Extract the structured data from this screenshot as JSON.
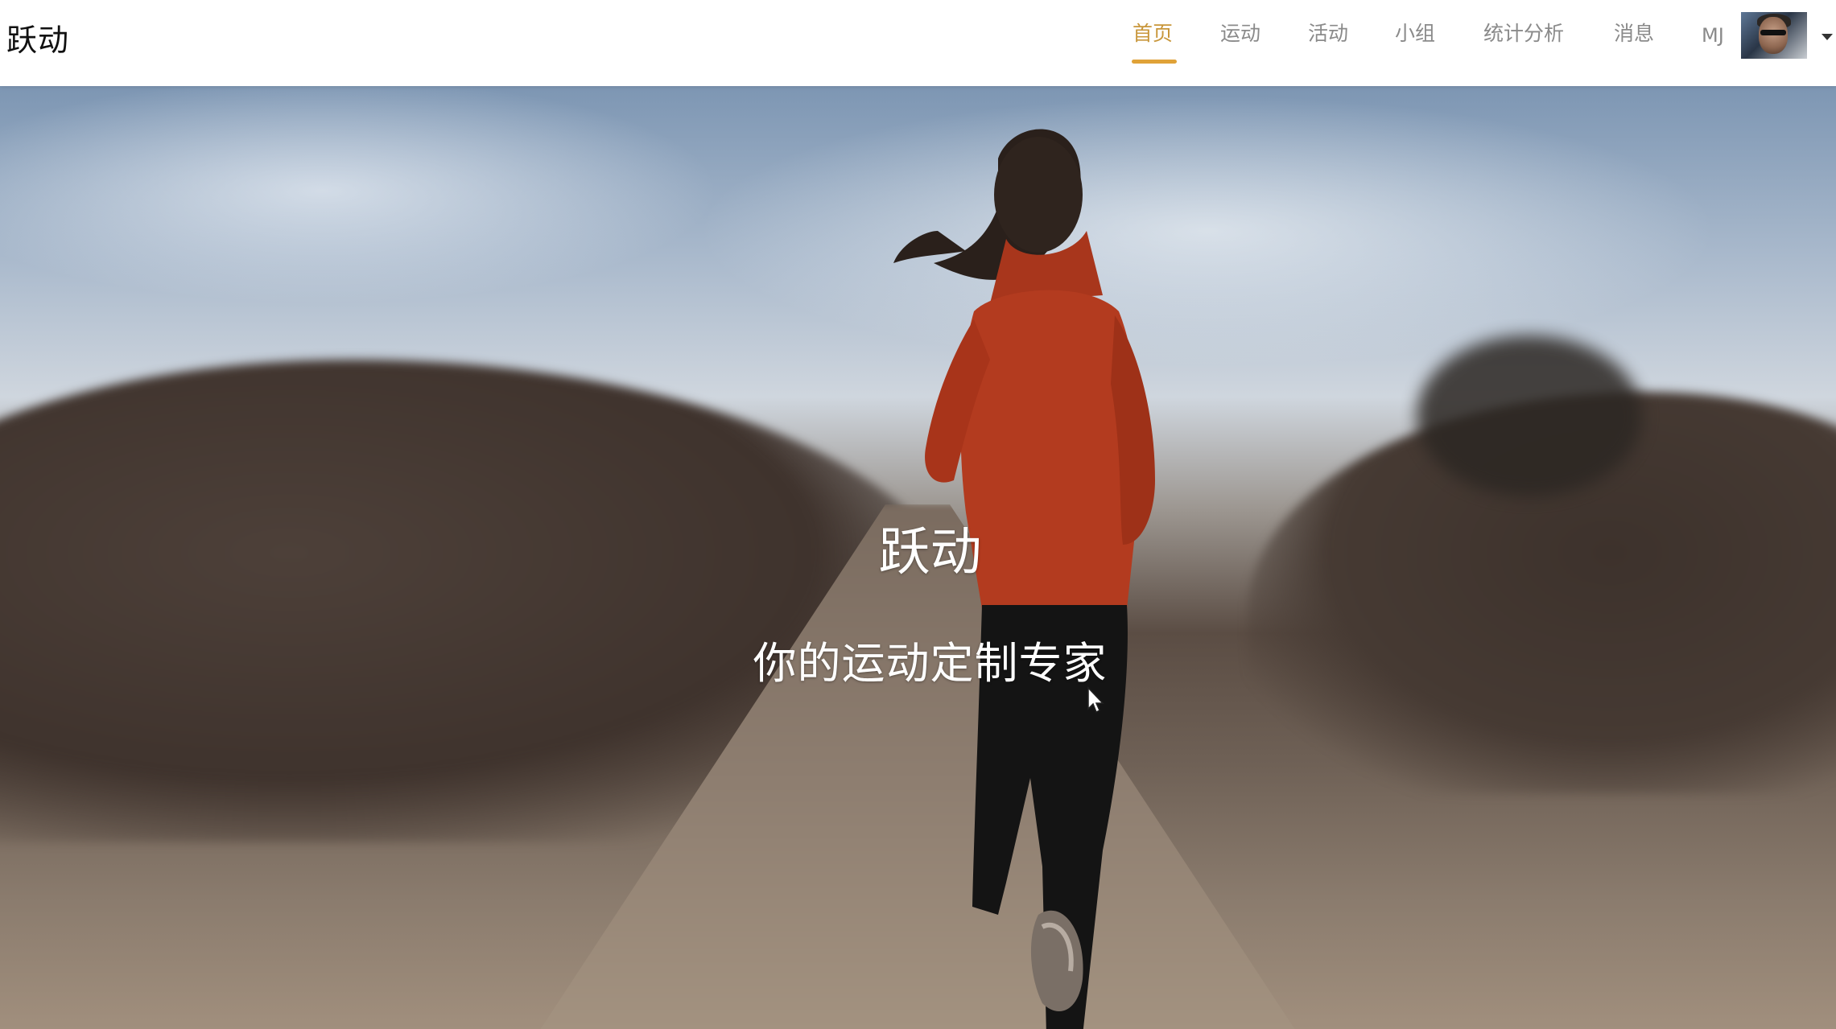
{
  "header": {
    "brand": "跃动",
    "nav": [
      {
        "label": "首页",
        "active": true
      },
      {
        "label": "运动",
        "active": false
      },
      {
        "label": "活动",
        "active": false
      },
      {
        "label": "小组",
        "active": false
      },
      {
        "label": "统计分析",
        "active": false
      },
      {
        "label": "消息",
        "active": false
      }
    ],
    "user": {
      "name": "MJ"
    }
  },
  "hero": {
    "title": "跃动",
    "subtitle": "你的运动定制专家"
  },
  "colors": {
    "accent": "#e0a238",
    "nav_text": "#8a8a8a",
    "active_text": "#c8963a",
    "runner_jacket": "#b23a1f",
    "runner_pants": "#151515"
  },
  "icons": {
    "avatar": "user-avatar-photo",
    "dropdown": "caret-down-icon",
    "cursor": "mouse-cursor-icon"
  }
}
